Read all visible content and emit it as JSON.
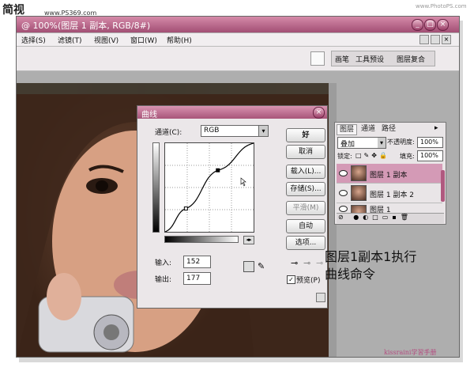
{
  "header": {
    "logo_text": "简视",
    "site_url": "www.PS369.com",
    "site_url_right": "www.PhotoPS.com"
  },
  "window": {
    "title": "@ 100%(图层 1 副本, RGB/8#)",
    "controls": [
      "_",
      "□",
      "×"
    ]
  },
  "menu": [
    "选择(S)",
    "滤镜(T)",
    "视图(V)",
    "窗口(W)",
    "帮助(H)"
  ],
  "palette_well": {
    "tabs": [
      "画笔",
      "工具预设",
      "图层复合"
    ]
  },
  "curves": {
    "title": "曲线",
    "channel_label": "通道(C):",
    "channel_value": "RGB",
    "buttons": {
      "ok": "好",
      "cancel": "取消",
      "load": "载入(L)...",
      "save": "存储(S)...",
      "smooth": "平滑(M)",
      "auto": "自动",
      "options": "选项..."
    },
    "input_label": "输入:",
    "input_value": "152",
    "output_label": "输出:",
    "output_value": "177",
    "preview_label": "预览(P)",
    "preview_checked": true,
    "curve_points": [
      [
        0,
        0
      ],
      [
        60,
        67
      ],
      [
        152,
        177
      ],
      [
        255,
        255
      ]
    ]
  },
  "layers": {
    "tabs": [
      "图层",
      "通道",
      "路径"
    ],
    "blend_mode": "叠加",
    "opacity_label": "不透明度:",
    "opacity_value": "100%",
    "lock_label": "锁定:",
    "fill_label": "填充:",
    "fill_value": "100%",
    "items": [
      {
        "name": "图层 1 副本",
        "selected": true
      },
      {
        "name": "图层 1 副本 2",
        "selected": false
      },
      {
        "name": "图层 1",
        "selected": false
      }
    ]
  },
  "caption": {
    "line1": "图层1副本1执行",
    "line2": "曲线命令"
  },
  "watermark": "kissraini学習手册",
  "colors": {
    "title_accent": "#b0597f",
    "selected_layer": "#d49ab6"
  }
}
